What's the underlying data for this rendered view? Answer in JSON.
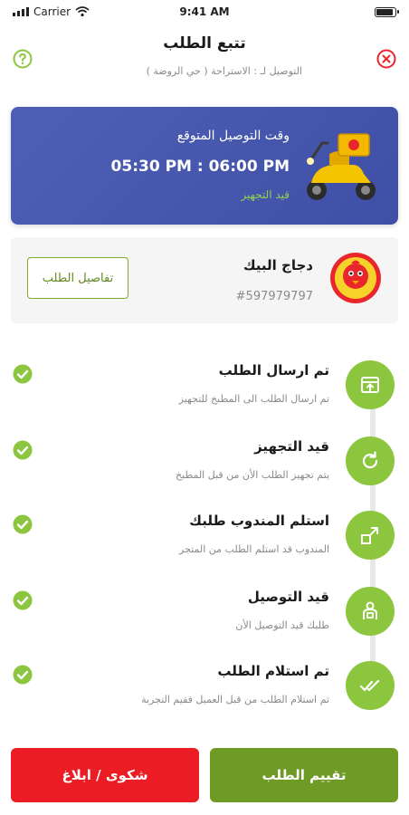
{
  "status_bar": {
    "carrier": "Carrier",
    "time": "9:41 AM"
  },
  "header": {
    "title": "تتبع الطلب",
    "subtitle": "التوصيل لـ : الاستراحة ( حي الروضة )"
  },
  "eta": {
    "label": "وقت التوصيل المتوقع",
    "time_range": "05:30 PM : 06:00 PM",
    "status": "قيد التجهيز"
  },
  "restaurant": {
    "name": "دجاج البيك",
    "order_number": "#597979797",
    "details_button": "تفاصيل الطلب"
  },
  "steps": [
    {
      "title": "تم ارسال الطلب",
      "desc": "تم ارسال الطلب الى المطبخ للتجهيز",
      "icon": "order-sent-icon",
      "completed": true
    },
    {
      "title": "قيد التجهيز",
      "desc": "يتم تجهيز الطلب الأن من قبل المطبخ",
      "icon": "refresh-icon",
      "completed": true
    },
    {
      "title": "استلم المندوب طلبك",
      "desc": "المندوب قد استلم الطلب من المتجر",
      "icon": "handover-icon",
      "completed": true
    },
    {
      "title": "قيد التوصيل",
      "desc": "طلبك قيد التوصيل الأن",
      "icon": "delivery-person-icon",
      "completed": true
    },
    {
      "title": "تم استلام الطلب",
      "desc": "تم استلام الطلب من قبل العميل فقيم التجربة",
      "icon": "double-check-icon",
      "completed": true
    }
  ],
  "actions": {
    "rate": "تقييم الطلب",
    "complain": "شكوى / ابلاغ"
  },
  "colors": {
    "eta_card": "#4e5fb5",
    "accent_green": "#8cc63f",
    "rate_button": "#6e9b26",
    "complain_button": "#ec1c24",
    "close_red": "#e8262c"
  }
}
